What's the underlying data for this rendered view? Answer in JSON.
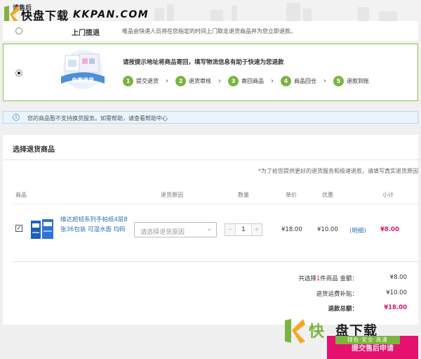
{
  "watermark": {
    "brand_cn": "快盘下载",
    "brand_en": "KKPAN.COM",
    "brand_cn_bottom_1": "快",
    "brand_cn_bottom_2": "盘下载",
    "slogan": "绿色·安全·高速"
  },
  "breadcrumb_fragment": "请售后",
  "options": [
    {
      "name": "上门揽退",
      "description": "唯品会快递人员将在您指定的时间上门取走退货商品并为您立即退款。",
      "selected": false
    },
    {
      "name": "自寄退货",
      "headline": "请按提示地址将商品寄回，填写物流信息有助于快速为您退款",
      "selected": true,
      "steps": [
        {
          "num": "1",
          "label": "提交退货"
        },
        {
          "num": "2",
          "label": "退货审核"
        },
        {
          "num": "3",
          "label": "寄回商品"
        },
        {
          "num": "4",
          "label": "商品回仓"
        },
        {
          "num": "5",
          "label": "退款到账"
        }
      ]
    }
  ],
  "info": {
    "icon": "info-icon",
    "text": "您的商品暂不支持换货服务。如需帮助，请查看帮助中心"
  },
  "panel": {
    "title": "选择退货商品",
    "note": "*为了给您提供更好的退货服务和极速退款，请填写真实退货原因",
    "columns": [
      "商品",
      "退货原因",
      "数量",
      "单价",
      "优惠",
      "小计"
    ],
    "items": [
      {
        "checked": true,
        "name": "维达超韧系列手帕纸4层8张36包装 可湿水面 均码",
        "reason_placeholder": "请选择退货原因",
        "quantity": "1",
        "minus": "−",
        "plus": "+",
        "unit_price": "¥18.00",
        "discount": "¥10.00",
        "discount_detail": "(明细)",
        "subtotal": "¥8.00"
      }
    ],
    "summary": {
      "selected_prefix": "共选择",
      "selected_count": "1",
      "selected_suffix": "件商品 金额：",
      "amount": "¥8.00",
      "shipping_label": "退货运费补贴：",
      "shipping": "¥10.00",
      "total_label": "退款总额：",
      "total": "¥18.00"
    }
  },
  "submit_label": "提交售后申请",
  "colors": {
    "accent_green": "#7cb342",
    "accent_pink": "#e6106e",
    "link_blue": "#3670b5"
  }
}
